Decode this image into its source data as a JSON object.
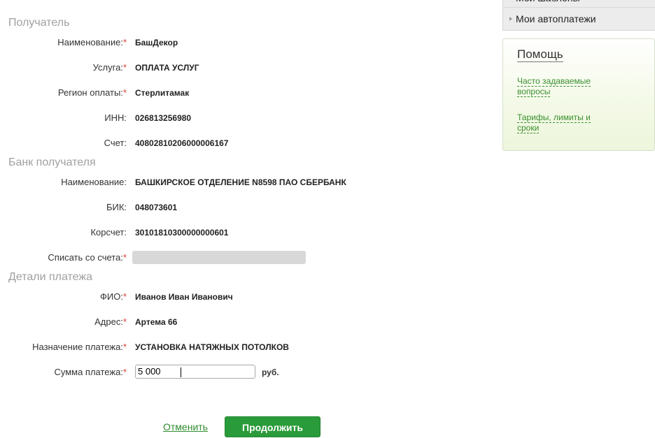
{
  "recipient": {
    "title": "Получатель",
    "fields": [
      {
        "label": "Наименование:",
        "required": "*",
        "value": "БашДекор"
      },
      {
        "label": "Услуга:",
        "required": "*",
        "value": "ОПЛАТА УСЛУГ"
      },
      {
        "label": "Регион оплаты:",
        "required": "*",
        "value": "Стерлитамак"
      },
      {
        "label": "ИНН:",
        "required": "",
        "value": "026813256980"
      },
      {
        "label": "Счет:",
        "required": "",
        "value": "40802810206000006167"
      }
    ]
  },
  "bank": {
    "title": "Банк получателя",
    "fields": [
      {
        "label": "Наименование:",
        "required": "",
        "value": "БАШКИРСКОЕ ОТДЕЛЕНИЕ N8598 ПАО СБЕРБАНК"
      },
      {
        "label": "БИК:",
        "required": "",
        "value": "048073601"
      },
      {
        "label": "Корсчет:",
        "required": "",
        "value": "30101810300000000601"
      }
    ],
    "debit_account": {
      "label": "Списать со счета:",
      "required": "*"
    }
  },
  "payment_details": {
    "title": "Детали платежа",
    "fields": [
      {
        "label": "ФИО:",
        "required": "*",
        "value": "Иванов Иван Иванович"
      },
      {
        "label": "Адрес:",
        "required": "*",
        "value": "Артема 66"
      },
      {
        "label": "Назначение платежа:",
        "required": "*",
        "value": "УСТАНОВКА НАТЯЖНЫХ ПОТОЛКОВ"
      }
    ],
    "amount": {
      "label": "Сумма платежа:",
      "required": "*",
      "value": "5 000",
      "unit": "руб."
    }
  },
  "actions": {
    "cancel_label": "Отменить",
    "continue_label": "Продолжить"
  },
  "sidebar": {
    "menu_items": [
      {
        "label": "Мои шаблоны"
      },
      {
        "label": "Мои автоплатежи"
      }
    ],
    "help": {
      "title": "Помощь",
      "links": [
        {
          "label": "Часто задаваемые вопросы"
        },
        {
          "label": "Тарифы, лимиты и сроки"
        }
      ]
    }
  },
  "colors": {
    "accent_green": "#2a9b3a",
    "link_green": "#3a8f2e",
    "required_mark": "#d63a2f",
    "section_title": "#a0a0a0"
  }
}
